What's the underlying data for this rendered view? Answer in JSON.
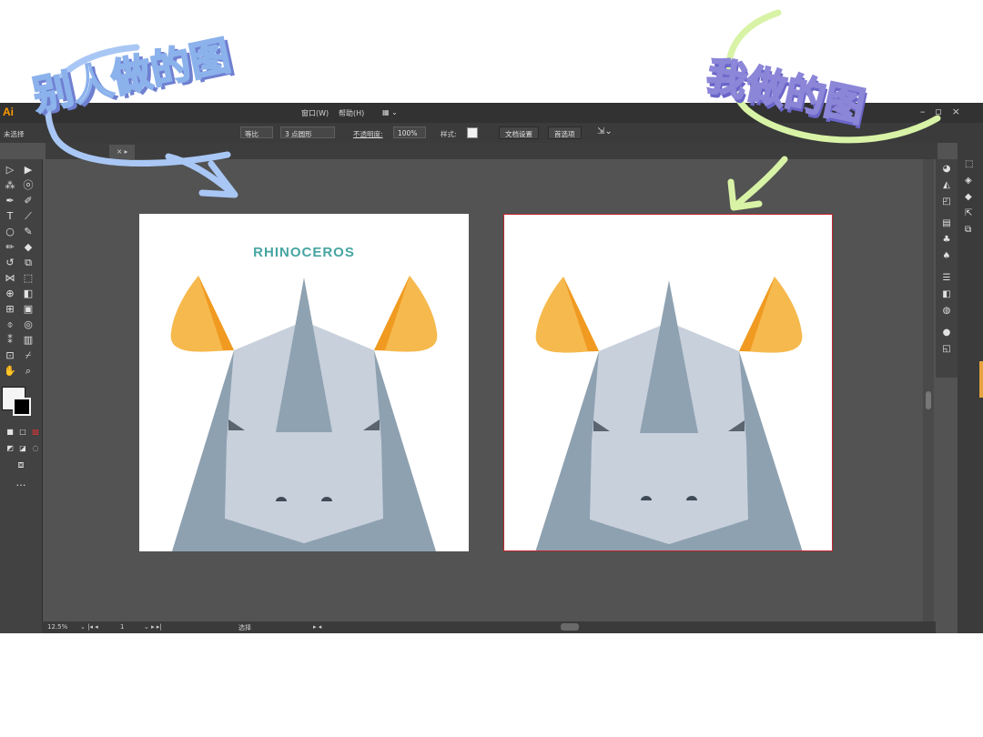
{
  "app": {
    "logo": "Ai",
    "menu": {
      "window": "窗口(W)",
      "help": "帮助(H)"
    },
    "controls": {
      "no_selection": "未选择",
      "uniform": "等比",
      "brush": "3 点圆形",
      "opacity_label": "不透明度:",
      "opacity_value": "100%",
      "style_label": "样式:",
      "doc_setup": "文档设置",
      "preferences": "首选项"
    },
    "status": {
      "zoom": "12.5%",
      "artboard": "1",
      "tool": "选择"
    }
  },
  "artboards": {
    "left_title": "RHINOCEROS"
  },
  "annotations": {
    "others_label": "别人做的图",
    "mine_label": "我做的图"
  },
  "colors": {
    "ear": "#f6b94d",
    "ear_shade": "#f09a21",
    "head": "#c8d0dc",
    "side": "#8ea1b0",
    "horn": "#8fa2b1",
    "eye": "#5a6570",
    "nostril": "#3e4a56",
    "title": "#46a5a1",
    "sticker_blue": "#8cb2ec",
    "sticker_green": "#d8f3a6",
    "artboard_border": "#c0262e"
  },
  "icons": [
    "selection-icon",
    "direct-selection-icon",
    "pen-icon",
    "type-icon",
    "ellipse-icon",
    "brush-icon",
    "rotate-icon",
    "scale-icon",
    "eyedropper-icon",
    "hand-icon",
    "zoom-icon"
  ]
}
